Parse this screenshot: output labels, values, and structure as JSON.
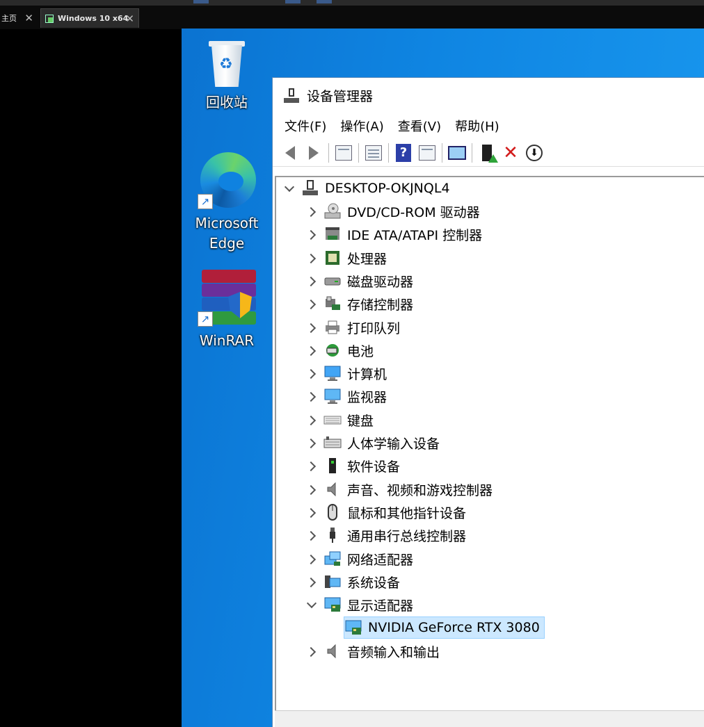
{
  "host_tabs": [
    {
      "label": "主页"
    },
    {
      "label": "Windows 10 x64"
    }
  ],
  "desktop_icons": {
    "recycle_bin": "回收站",
    "edge": "Microsoft\nEdge",
    "edge_line1": "Microsoft",
    "edge_line2": "Edge",
    "winrar": "WinRAR"
  },
  "window": {
    "title": "设备管理器",
    "menu": [
      "文件(F)",
      "操作(A)",
      "查看(V)",
      "帮助(H)"
    ],
    "toolbar_icons": [
      "back-arrow-icon",
      "forward-arrow-icon",
      "show-hide-console-tree-icon",
      "properties-icon",
      "help-icon",
      "action-pane-icon",
      "scan-hardware-icon",
      "update-driver-icon",
      "uninstall-icon",
      "disable-device-icon"
    ]
  },
  "tree": {
    "root": "DESKTOP-OKJNQL4",
    "categories": [
      {
        "label": "DVD/CD-ROM 驱动器",
        "icon": "dvd-drive-icon"
      },
      {
        "label": "IDE ATA/ATAPI 控制器",
        "icon": "ide-controller-icon"
      },
      {
        "label": "处理器",
        "icon": "processor-icon"
      },
      {
        "label": "磁盘驱动器",
        "icon": "disk-drive-icon"
      },
      {
        "label": "存储控制器",
        "icon": "storage-controller-icon"
      },
      {
        "label": "打印队列",
        "icon": "printer-icon"
      },
      {
        "label": "电池",
        "icon": "battery-icon"
      },
      {
        "label": "计算机",
        "icon": "computer-icon"
      },
      {
        "label": "监视器",
        "icon": "monitor-icon"
      },
      {
        "label": "键盘",
        "icon": "keyboard-icon"
      },
      {
        "label": "人体学输入设备",
        "icon": "hid-icon"
      },
      {
        "label": "软件设备",
        "icon": "software-device-icon"
      },
      {
        "label": "声音、视频和游戏控制器",
        "icon": "sound-icon"
      },
      {
        "label": "鼠标和其他指针设备",
        "icon": "mouse-icon"
      },
      {
        "label": "通用串行总线控制器",
        "icon": "usb-icon"
      },
      {
        "label": "网络适配器",
        "icon": "network-adapter-icon"
      },
      {
        "label": "系统设备",
        "icon": "system-device-icon"
      },
      {
        "label": "显示适配器",
        "icon": "display-adapter-icon",
        "expanded": true
      },
      {
        "label": "NVIDIA GeForce RTX 3080",
        "icon": "display-adapter-icon",
        "child": true,
        "selected": true
      },
      {
        "label": "音频输入和输出",
        "icon": "audio-io-icon"
      }
    ]
  },
  "colors": {
    "desktop_blue": "#0f85e2",
    "selection": "#cce8ff"
  }
}
